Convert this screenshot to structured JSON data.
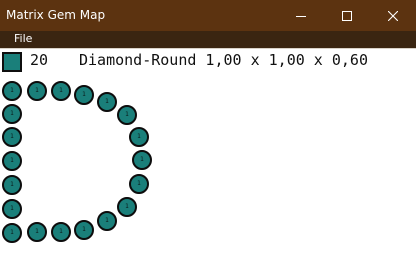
{
  "window": {
    "title": "Matrix Gem Map"
  },
  "menu": {
    "file_label": "File"
  },
  "info": {
    "swatch_color": "#1a7f7a",
    "count": "20",
    "description": "Diamond-Round 1,00 x 1,00 x 0,60"
  },
  "gems": {
    "label": "1",
    "fill_color": "#1a7f7a",
    "outline_color": "#0d0d0d"
  },
  "icons": {
    "minimize": "minimize-icon",
    "maximize": "maximize-icon",
    "close": "close-icon"
  }
}
